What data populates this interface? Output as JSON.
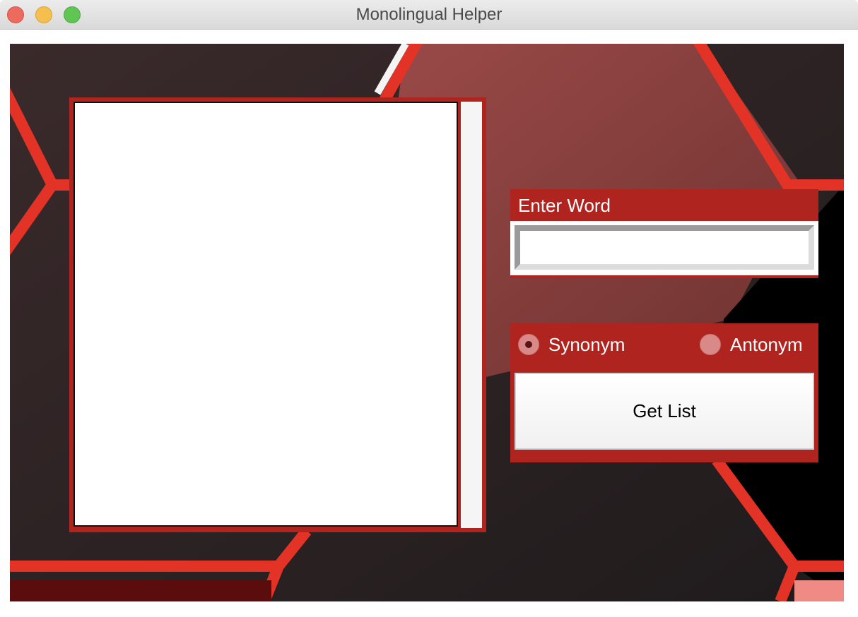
{
  "window": {
    "title": "Monolingual Helper"
  },
  "word_panel": {
    "label": "Enter Word",
    "input_value": ""
  },
  "options": {
    "synonym_label": "Synonym",
    "antonym_label": "Antonym",
    "selected": "Synonym",
    "get_list_label": "Get List"
  },
  "results": {
    "text": ""
  },
  "colors": {
    "panel_red": "#b0241f",
    "hex_red": "#e33327",
    "background_dark": "#2a2526"
  }
}
